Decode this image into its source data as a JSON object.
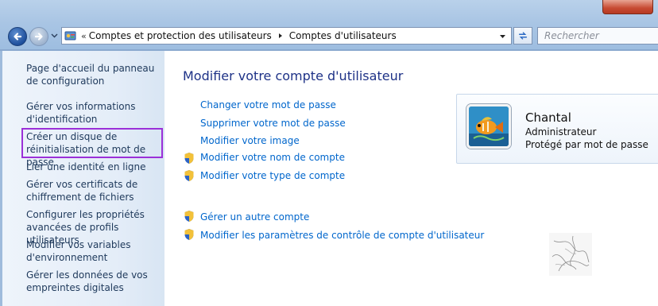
{
  "address_bar": {
    "separator": "«",
    "crumbs": [
      "Comptes et protection des utilisateurs",
      "Comptes d'utilisateurs"
    ]
  },
  "search": {
    "placeholder": "Rechercher"
  },
  "sidebar": {
    "items": [
      {
        "label": "Page d'accueil du panneau de configuration"
      },
      {
        "label": "Gérer vos informations d'identification"
      },
      {
        "label": "Créer un disque de réinitialisation de mot de passe"
      },
      {
        "label": "Lier une identité en ligne"
      },
      {
        "label": "Gérer vos certificats de chiffrement de fichiers"
      },
      {
        "label": "Configurer les propriétés avancées de profils utilisateurs"
      },
      {
        "label": "Modifier vos variables d'environnement"
      },
      {
        "label": "Gérer les données de vos empreintes digitales"
      }
    ],
    "highlighted_index": 2,
    "highlight_color": "#9b30d8"
  },
  "main": {
    "title": "Modifier votre compte d'utilisateur",
    "tasks": [
      {
        "label": "Changer votre mot de passe",
        "icon": "none"
      },
      {
        "label": "Supprimer votre mot de passe",
        "icon": "none"
      },
      {
        "label": "Modifier votre image",
        "icon": "none"
      },
      {
        "label": "Modifier votre nom de compte",
        "icon": "uac-shield-icon"
      },
      {
        "label": "Modifier votre type de compte",
        "icon": "uac-shield-icon"
      }
    ],
    "other_tasks": [
      {
        "label": "Gérer un autre compte",
        "icon": "uac-shield-icon"
      },
      {
        "label": "Modifier les paramètres de contrôle de compte d'utilisateur",
        "icon": "uac-shield-icon"
      }
    ]
  },
  "user_card": {
    "name": "Chantal",
    "role": "Administrateur",
    "protection": "Protégé par mot de passe",
    "picture": "fish-picture"
  },
  "colors": {
    "link": "#0066cc",
    "title": "#1e3287",
    "sidebar_link": "#1e395b"
  }
}
